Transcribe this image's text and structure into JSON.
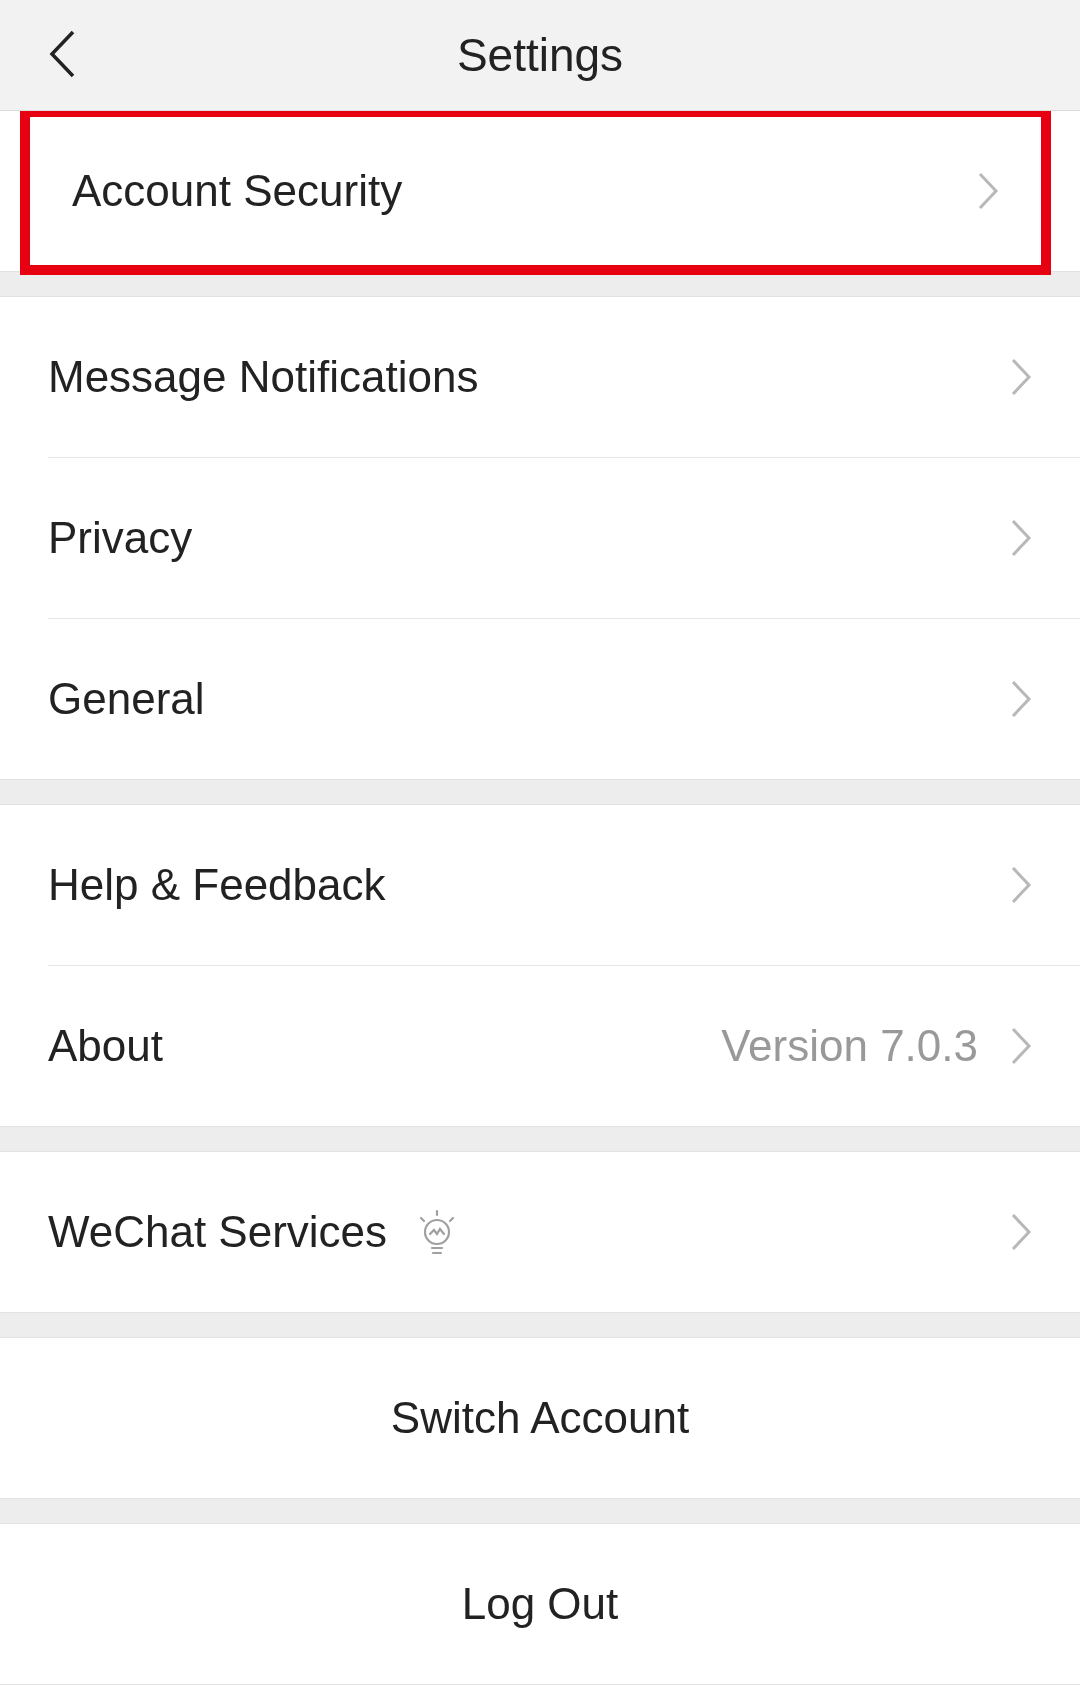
{
  "header": {
    "title": "Settings"
  },
  "groups": [
    {
      "items": [
        {
          "kind": "link",
          "label": "Account Security",
          "highlighted": true
        }
      ]
    },
    {
      "items": [
        {
          "kind": "link",
          "label": "Message Notifications",
          "highlighted": false
        },
        {
          "kind": "link",
          "label": "Privacy",
          "highlighted": false
        },
        {
          "kind": "link",
          "label": "General",
          "highlighted": false
        }
      ]
    },
    {
      "items": [
        {
          "kind": "link",
          "label": "Help & Feedback",
          "highlighted": false
        },
        {
          "kind": "link",
          "label": "About",
          "value": "Version 7.0.3",
          "highlighted": false
        }
      ]
    },
    {
      "items": [
        {
          "kind": "link_icon",
          "label": "WeChat Services",
          "highlighted": false
        }
      ]
    },
    {
      "items": [
        {
          "kind": "action",
          "label": "Switch Account",
          "highlighted": false
        }
      ]
    },
    {
      "items": [
        {
          "kind": "action",
          "label": "Log Out",
          "highlighted": false
        }
      ]
    }
  ]
}
